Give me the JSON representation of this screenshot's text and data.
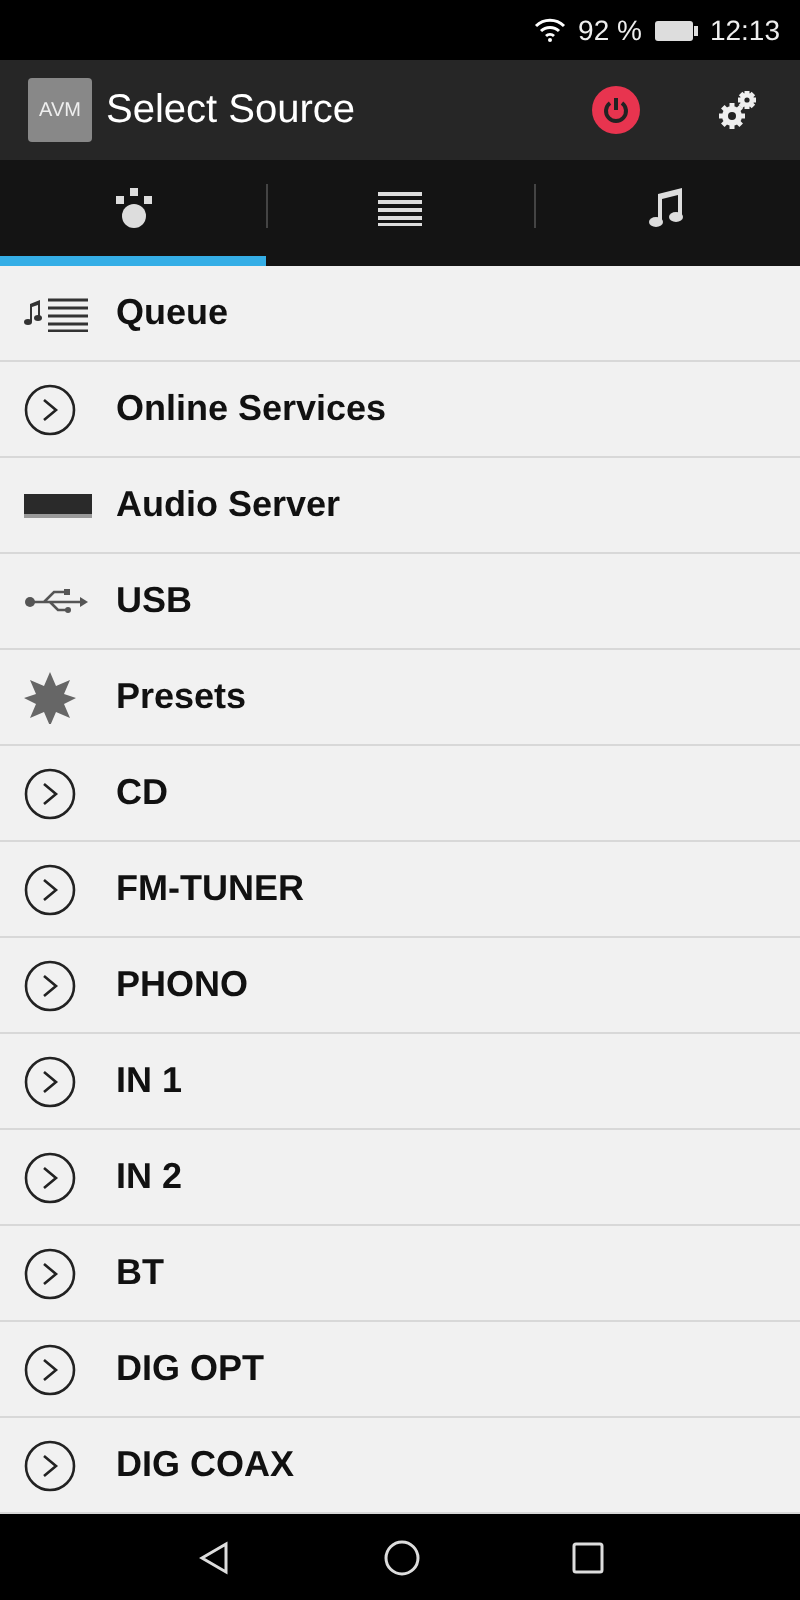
{
  "status_bar": {
    "battery": "92 %",
    "time": "12:13"
  },
  "app_bar": {
    "logo": "AVM",
    "title": "Select Source"
  },
  "tabs": [
    {
      "kind": "sources",
      "selected": true
    },
    {
      "kind": "list",
      "selected": false
    },
    {
      "kind": "music",
      "selected": false
    }
  ],
  "sources": [
    {
      "kind": "queue",
      "label": "Queue"
    },
    {
      "kind": "circle",
      "label": "Online Services"
    },
    {
      "kind": "server",
      "label": "Audio Server"
    },
    {
      "kind": "usb",
      "label": "USB"
    },
    {
      "kind": "star",
      "label": "Presets"
    },
    {
      "kind": "circle",
      "label": "CD"
    },
    {
      "kind": "circle",
      "label": "FM-TUNER"
    },
    {
      "kind": "circle",
      "label": "PHONO"
    },
    {
      "kind": "circle",
      "label": "IN 1"
    },
    {
      "kind": "circle",
      "label": "IN 2"
    },
    {
      "kind": "circle",
      "label": "BT"
    },
    {
      "kind": "circle",
      "label": "DIG OPT"
    },
    {
      "kind": "circle",
      "label": "DIG COAX"
    }
  ]
}
